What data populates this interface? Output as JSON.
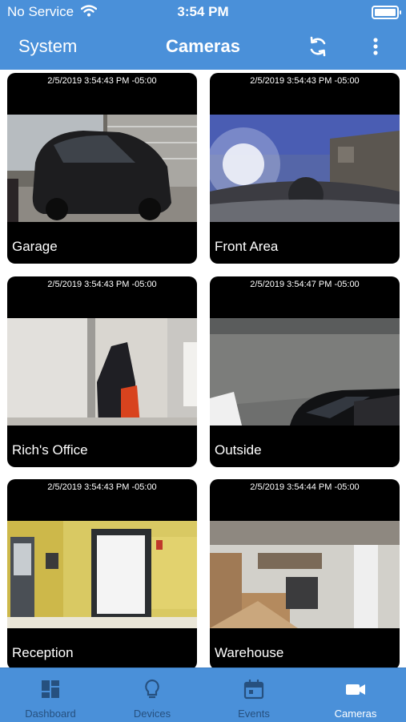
{
  "status": {
    "carrier": "No Service",
    "time": "3:54 PM"
  },
  "nav": {
    "back_label": "System",
    "title": "Cameras",
    "refresh_icon": "refresh-icon",
    "more_icon": "more-vertical-icon"
  },
  "cameras": [
    {
      "timestamp": "2/5/2019 3:54:43 PM -05:00",
      "name": "Garage"
    },
    {
      "timestamp": "2/5/2019 3:54:43 PM -05:00",
      "name": "Front Area"
    },
    {
      "timestamp": "2/5/2019 3:54:43 PM -05:00",
      "name": "Rich's Office"
    },
    {
      "timestamp": "2/5/2019 3:54:47 PM -05:00",
      "name": "Outside"
    },
    {
      "timestamp": "2/5/2019 3:54:43 PM -05:00",
      "name": "Reception"
    },
    {
      "timestamp": "2/5/2019 3:54:44 PM -05:00",
      "name": "Warehouse"
    }
  ],
  "tabs": [
    {
      "label": "Dashboard",
      "icon": "dashboard-icon"
    },
    {
      "label": "Devices",
      "icon": "lightbulb-icon"
    },
    {
      "label": "Events",
      "icon": "calendar-icon"
    },
    {
      "label": "Cameras",
      "icon": "video-camera-icon",
      "active": true
    }
  ],
  "colors": {
    "brand": "#4a90d9",
    "tab_inactive": "#26507f",
    "tab_active": "#ffffff"
  }
}
